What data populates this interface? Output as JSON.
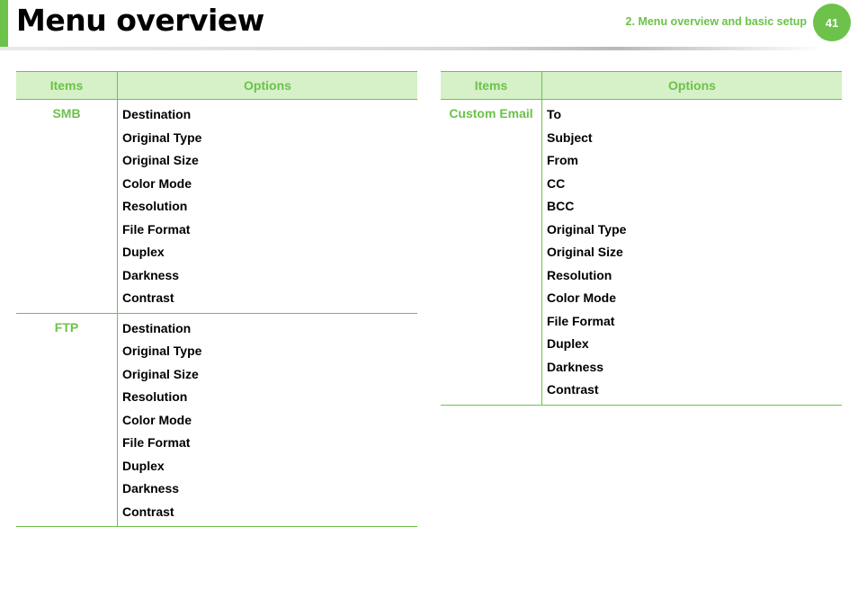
{
  "header": {
    "title": "Menu overview",
    "chapter": "2.  Menu overview and basic setup",
    "page_number": "41"
  },
  "colors": {
    "accent": "#6cc24a",
    "header_fill": "#d6f0c8"
  },
  "left_table": {
    "headers": {
      "items": "Items",
      "options": "Options"
    },
    "rows": [
      {
        "item": "SMB",
        "options": [
          "Destination",
          "Original Type",
          "Original Size",
          "Color Mode",
          "Resolution",
          "File Format",
          "Duplex",
          "Darkness",
          "Contrast"
        ]
      },
      {
        "item": "FTP",
        "options": [
          "Destination",
          "Original Type",
          "Original Size",
          "Resolution",
          "Color Mode",
          "File Format",
          "Duplex",
          "Darkness",
          "Contrast"
        ]
      }
    ]
  },
  "right_table": {
    "headers": {
      "items": "Items",
      "options": "Options"
    },
    "rows": [
      {
        "item": "Custom Email",
        "options": [
          "To",
          "Subject",
          "From",
          "CC",
          "BCC",
          "Original Type",
          "Original Size",
          "Resolution",
          "Color Mode",
          "File Format",
          "Duplex",
          "Darkness",
          "Contrast"
        ]
      }
    ]
  }
}
